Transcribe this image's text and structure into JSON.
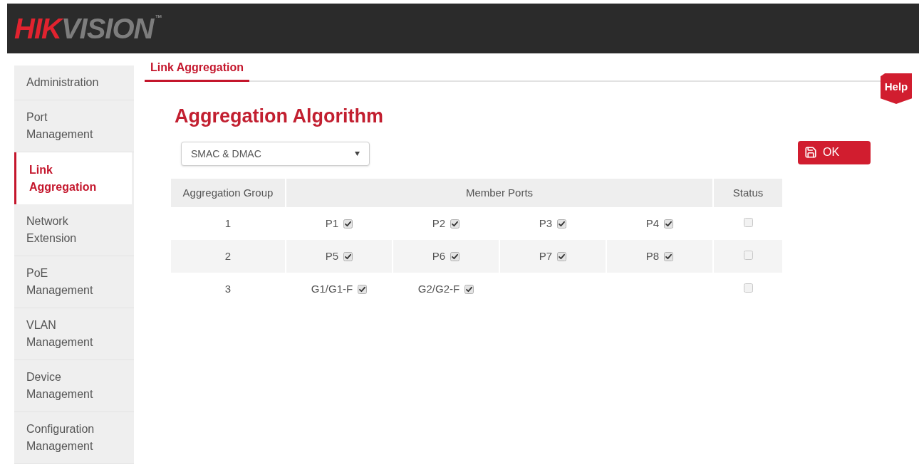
{
  "header": {
    "logo": {
      "part_1": "HIK",
      "part_2": "VISION",
      "trademark": "™"
    }
  },
  "sidebar": {
    "items": [
      {
        "label": "Administration",
        "selected": false
      },
      {
        "label": "Port Management",
        "selected": false
      },
      {
        "label": "Link Aggregation",
        "selected": true
      },
      {
        "label": "Network Extension",
        "selected": false
      },
      {
        "label": "PoE Management",
        "selected": false
      },
      {
        "label": "VLAN Management",
        "selected": false
      },
      {
        "label": "Device Management",
        "selected": false
      },
      {
        "label": "Configuration Management",
        "selected": false
      }
    ]
  },
  "tabs": [
    {
      "label": "Link Aggregation",
      "selected": true
    }
  ],
  "help_button": "Help",
  "title": "Aggregation Algorithm",
  "algorithm_select": {
    "value": "SMAC & DMAC"
  },
  "ok_button": "OK",
  "table": {
    "columns": [
      "Aggregation Group",
      "Member Ports",
      "Status"
    ],
    "rows": [
      {
        "group": "1",
        "ports": [
          {
            "name": "P1",
            "checked": true
          },
          {
            "name": "P2",
            "checked": true
          },
          {
            "name": "P3",
            "checked": true
          },
          {
            "name": "P4",
            "checked": true
          }
        ],
        "status": {
          "checked": false
        }
      },
      {
        "group": "2",
        "ports": [
          {
            "name": "P5",
            "checked": true
          },
          {
            "name": "P6",
            "checked": true
          },
          {
            "name": "P7",
            "checked": true
          },
          {
            "name": "P8",
            "checked": true
          }
        ],
        "status": {
          "checked": false
        }
      },
      {
        "group": "3",
        "ports": [
          {
            "name": "G1/G1-F",
            "checked": true
          },
          {
            "name": "G2/G2-F",
            "checked": true
          }
        ],
        "status": {
          "checked": false
        }
      }
    ]
  }
}
